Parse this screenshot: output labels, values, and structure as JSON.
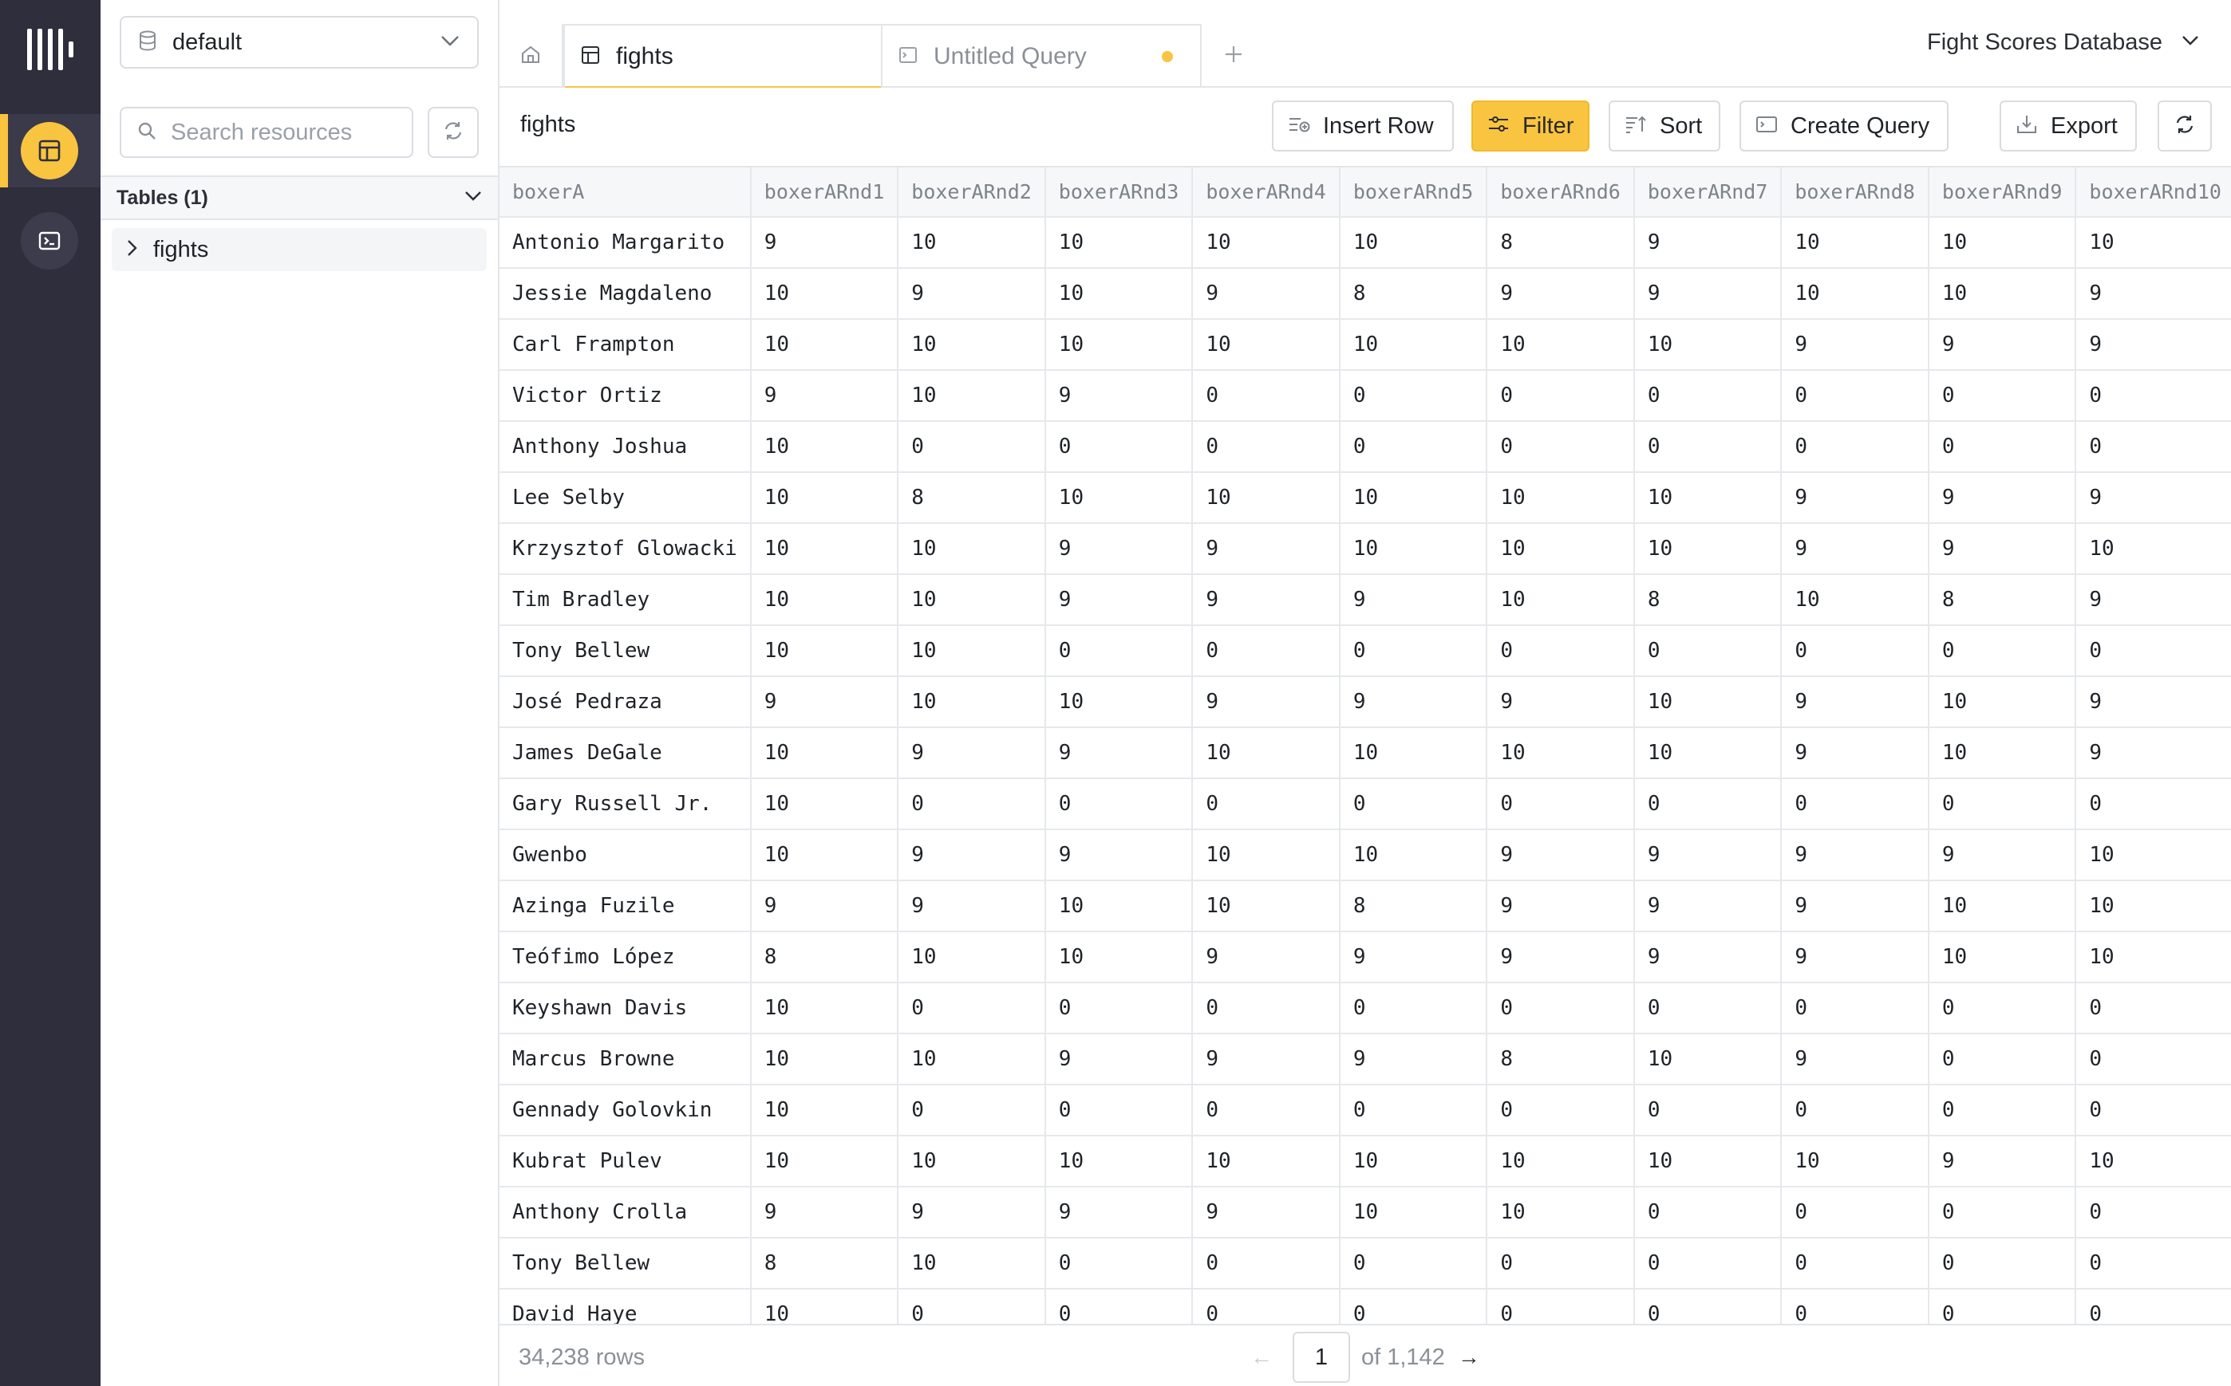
{
  "colors": {
    "accent": "#f9c440",
    "rail_bg": "#2f2e3d"
  },
  "sidebar": {
    "database": "default",
    "search_placeholder": "Search resources",
    "tables_header": "Tables (1)",
    "tables": [
      "fights"
    ]
  },
  "tabs": [
    {
      "label": "fights",
      "icon": "table-icon",
      "active": true
    },
    {
      "label": "Untitled Query",
      "icon": "terminal-icon",
      "unsaved": true
    }
  ],
  "workspace": "Fight Scores Database",
  "toolbar": {
    "title": "fights",
    "insert_row": "Insert Row",
    "filter": "Filter",
    "sort": "Sort",
    "create_query": "Create Query",
    "export": "Export"
  },
  "grid": {
    "columns": [
      "boxerA",
      "boxerARnd1",
      "boxerARnd2",
      "boxerARnd3",
      "boxerARnd4",
      "boxerARnd5",
      "boxerARnd6",
      "boxerARnd7",
      "boxerARnd8",
      "boxerARnd9",
      "boxerARnd10"
    ],
    "rows": [
      [
        "Antonio Margarito",
        "9",
        "10",
        "10",
        "10",
        "10",
        "8",
        "9",
        "10",
        "10",
        "10"
      ],
      [
        "Jessie Magdaleno",
        "10",
        "9",
        "10",
        "9",
        "8",
        "9",
        "9",
        "10",
        "10",
        "9"
      ],
      [
        "Carl Frampton",
        "10",
        "10",
        "10",
        "10",
        "10",
        "10",
        "10",
        "9",
        "9",
        "9"
      ],
      [
        "Victor Ortiz",
        "9",
        "10",
        "9",
        "0",
        "0",
        "0",
        "0",
        "0",
        "0",
        "0"
      ],
      [
        "Anthony Joshua",
        "10",
        "0",
        "0",
        "0",
        "0",
        "0",
        "0",
        "0",
        "0",
        "0"
      ],
      [
        "Lee Selby",
        "10",
        "8",
        "10",
        "10",
        "10",
        "10",
        "10",
        "9",
        "9",
        "9"
      ],
      [
        "Krzysztof Glowacki",
        "10",
        "10",
        "9",
        "9",
        "10",
        "10",
        "10",
        "9",
        "9",
        "10"
      ],
      [
        "Tim Bradley",
        "10",
        "10",
        "9",
        "9",
        "9",
        "10",
        "8",
        "10",
        "8",
        "9"
      ],
      [
        "Tony Bellew",
        "10",
        "10",
        "0",
        "0",
        "0",
        "0",
        "0",
        "0",
        "0",
        "0"
      ],
      [
        "José Pedraza",
        "9",
        "10",
        "10",
        "9",
        "9",
        "9",
        "10",
        "9",
        "10",
        "9"
      ],
      [
        "James DeGale",
        "10",
        "9",
        "9",
        "10",
        "10",
        "10",
        "10",
        "9",
        "10",
        "9"
      ],
      [
        "Gary Russell Jr.",
        "10",
        "0",
        "0",
        "0",
        "0",
        "0",
        "0",
        "0",
        "0",
        "0"
      ],
      [
        "Gwenbo",
        "10",
        "9",
        "9",
        "10",
        "10",
        "9",
        "9",
        "9",
        "9",
        "10"
      ],
      [
        "Azinga Fuzile",
        "9",
        "9",
        "10",
        "10",
        "8",
        "9",
        "9",
        "9",
        "10",
        "10"
      ],
      [
        "Teófimo López",
        "8",
        "10",
        "10",
        "9",
        "9",
        "9",
        "9",
        "9",
        "10",
        "10"
      ],
      [
        "Keyshawn Davis",
        "10",
        "0",
        "0",
        "0",
        "0",
        "0",
        "0",
        "0",
        "0",
        "0"
      ],
      [
        "Marcus Browne",
        "10",
        "10",
        "9",
        "9",
        "9",
        "8",
        "10",
        "9",
        "0",
        "0"
      ],
      [
        "Gennady Golovkin",
        "10",
        "0",
        "0",
        "0",
        "0",
        "0",
        "0",
        "0",
        "0",
        "0"
      ],
      [
        "Kubrat Pulev",
        "10",
        "10",
        "10",
        "10",
        "10",
        "10",
        "10",
        "10",
        "9",
        "10"
      ],
      [
        "Anthony Crolla",
        "9",
        "9",
        "9",
        "9",
        "10",
        "10",
        "0",
        "0",
        "0",
        "0"
      ],
      [
        "Tony Bellew",
        "8",
        "10",
        "0",
        "0",
        "0",
        "0",
        "0",
        "0",
        "0",
        "0"
      ],
      [
        "David Haye",
        "10",
        "0",
        "0",
        "0",
        "0",
        "0",
        "0",
        "0",
        "0",
        "0"
      ]
    ]
  },
  "footer": {
    "row_count": "34,238 rows",
    "page": "1",
    "of_pages": "of 1,142",
    "prev_icon": "arrow-left-icon",
    "next_icon": "arrow-right-icon"
  }
}
